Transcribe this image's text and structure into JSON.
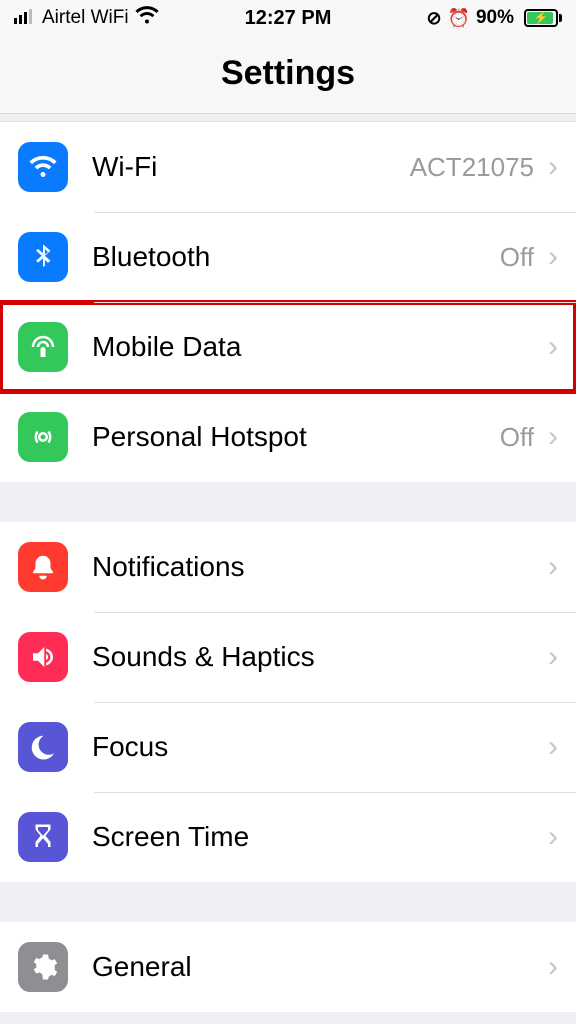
{
  "status": {
    "carrier": "Airtel WiFi",
    "time": "12:27 PM",
    "battery_pct": "90%"
  },
  "header": {
    "title": "Settings"
  },
  "group1": {
    "wifi": {
      "label": "Wi-Fi",
      "value": "ACT21075"
    },
    "bluetooth": {
      "label": "Bluetooth",
      "value": "Off"
    },
    "mobile": {
      "label": "Mobile Data",
      "value": ""
    },
    "hotspot": {
      "label": "Personal Hotspot",
      "value": "Off"
    }
  },
  "group2": {
    "notifications": {
      "label": "Notifications"
    },
    "sounds": {
      "label": "Sounds & Haptics"
    },
    "focus": {
      "label": "Focus"
    },
    "screentime": {
      "label": "Screen Time"
    }
  },
  "group3": {
    "general": {
      "label": "General"
    }
  }
}
